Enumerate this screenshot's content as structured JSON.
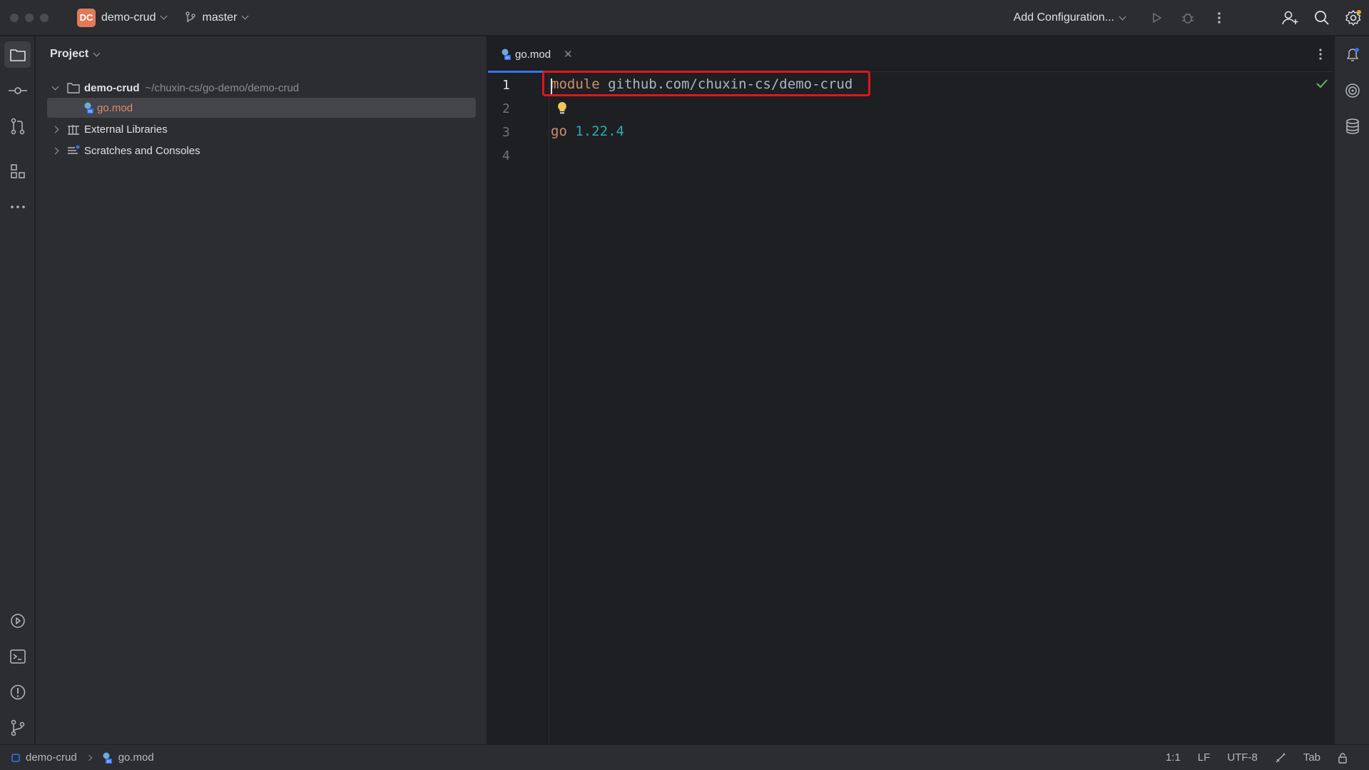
{
  "titlebar": {
    "project_badge": "DC",
    "project_name": "demo-crud",
    "branch": "master",
    "run_config": "Add Configuration..."
  },
  "project_panel": {
    "title": "Project",
    "tree": [
      {
        "label": "demo-crud",
        "path": "~/chuxin-cs/go-demo/demo-crud",
        "expanded": true
      },
      {
        "label": "go.mod",
        "selected": true
      },
      {
        "label": "External Libraries",
        "expanded": false
      },
      {
        "label": "Scratches and Consoles",
        "expanded": false
      }
    ]
  },
  "editor": {
    "tab_label": "go.mod",
    "line_numbers": [
      "1",
      "2",
      "3",
      "4"
    ],
    "line1_keyword": "module",
    "line1_value": "github.com/chuxin-cs/demo-crud",
    "line3_keyword": "go",
    "line3_value": "1.22.4"
  },
  "statusbar": {
    "breadcrumb_project": "demo-crud",
    "breadcrumb_file": "go.mod",
    "position": "1:1",
    "line_sep": "LF",
    "encoding": "UTF-8",
    "indent": "Tab"
  },
  "colors": {
    "accent": "#3574f0",
    "highlight_box": "#e0171b",
    "keyword": "#cf8e6d",
    "number": "#2aacb8"
  }
}
